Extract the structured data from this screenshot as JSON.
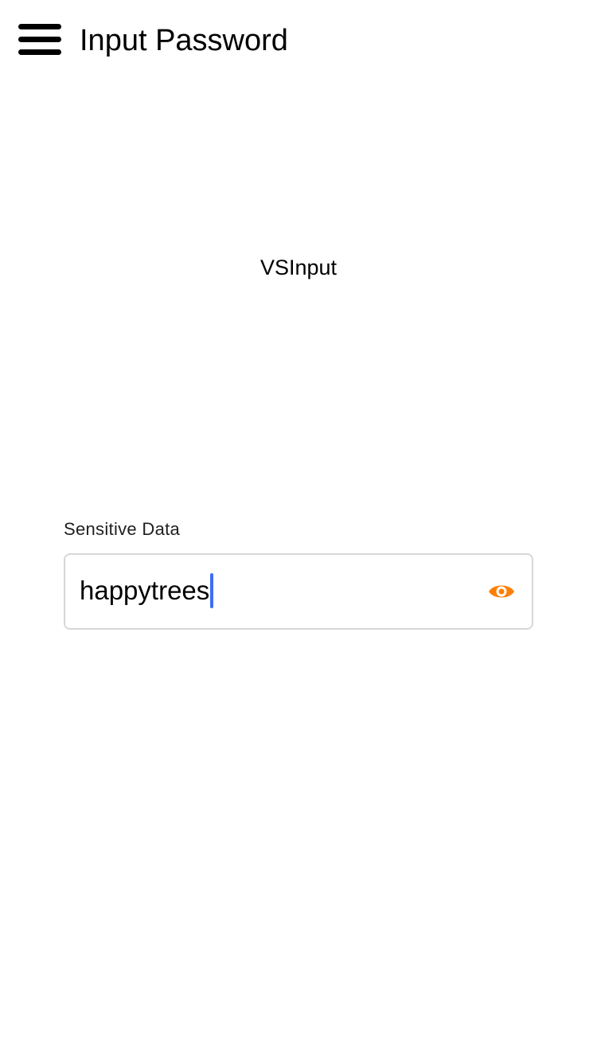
{
  "header": {
    "menu_icon": "hamburger-menu-icon",
    "title": "Input Password"
  },
  "main": {
    "component_name": "VSInput"
  },
  "password_field": {
    "label": "Sensitive Data",
    "value": "happytrees",
    "toggle_icon": "eye-icon",
    "accent_color": "#ff7f00",
    "caret_color": "#3f6df4",
    "border_color": "#d7d7d7"
  }
}
